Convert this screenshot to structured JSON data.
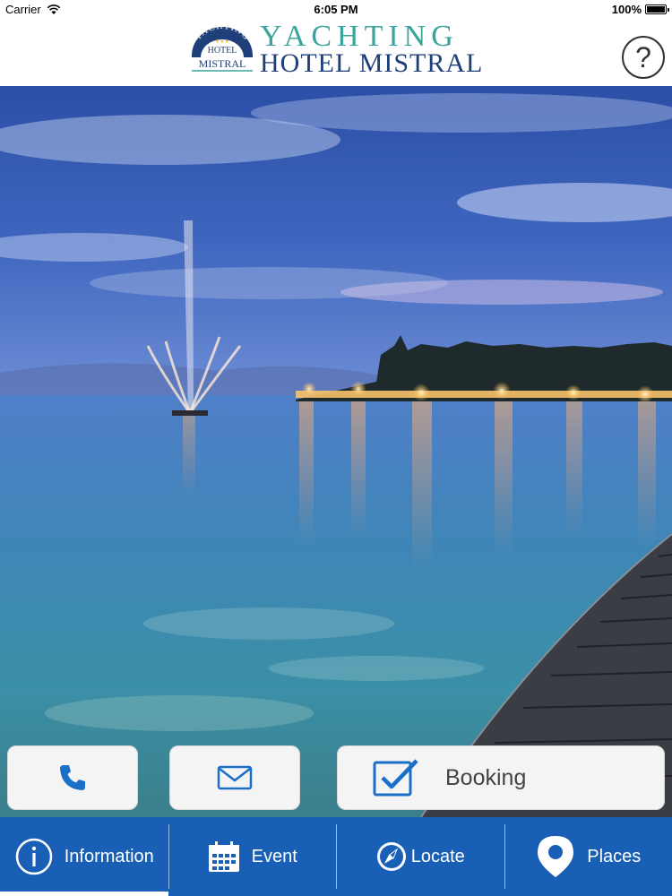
{
  "status_bar": {
    "carrier": "Carrier",
    "time": "6:05 PM",
    "battery": "100%"
  },
  "header": {
    "logo_badge": {
      "arc_text": "YACHTING",
      "line1": "HOTEL",
      "line2": "MISTRAL"
    },
    "brand_line1": "YACHTING",
    "brand_line2": "HOTEL MISTRAL",
    "help_label": "?"
  },
  "hero": {
    "image": "lake-at-dusk-with-fountain-and-pier"
  },
  "actions": {
    "call_icon": "phone-icon",
    "mail_icon": "envelope-icon",
    "booking_icon": "checkbox-icon",
    "booking_label": "Booking"
  },
  "tabbar": {
    "active_tab": "information",
    "tabs": [
      {
        "id": "information",
        "label": "Information",
        "icon": "info-icon"
      },
      {
        "id": "event",
        "label": "Event",
        "icon": "calendar-icon"
      },
      {
        "id": "locate",
        "label": "Locate",
        "icon": "compass-icon"
      },
      {
        "id": "places",
        "label": "Places",
        "icon": "map-pin-icon"
      }
    ]
  },
  "colors": {
    "tabbar_bg": "#1a5fb6",
    "accent_blue": "#1a6fc9",
    "brand_teal": "#3aa39a",
    "brand_navy": "#1f3f7a",
    "button_bg": "#f4f4f4"
  }
}
